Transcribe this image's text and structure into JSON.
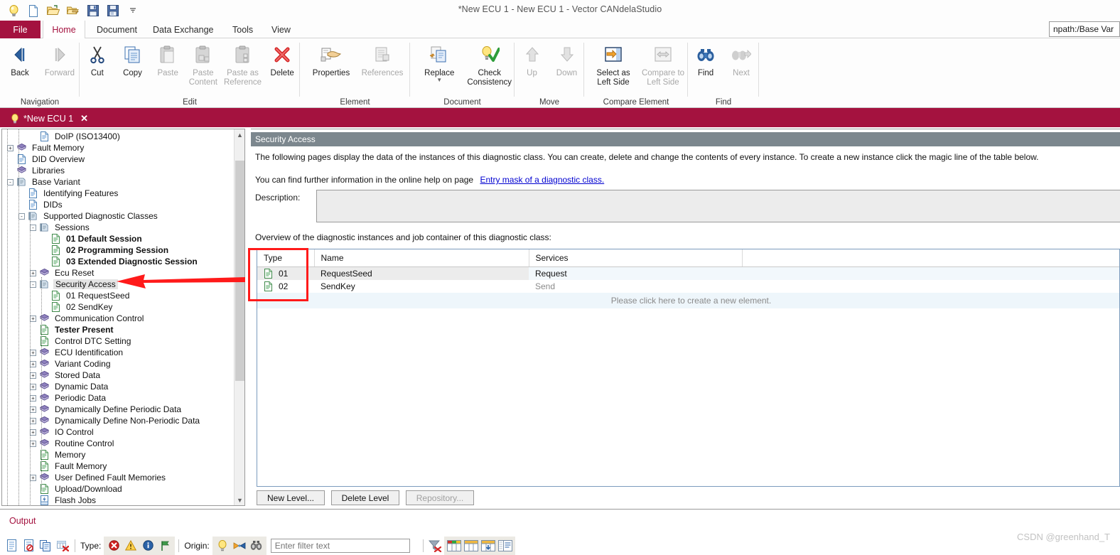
{
  "window": {
    "title": "*New ECU 1 - New ECU 1 - Vector CANdelaStudio"
  },
  "quick_access": {
    "items": [
      {
        "name": "candela-lamp-icon",
        "label": "CANdela"
      },
      {
        "name": "new-document-icon",
        "label": "New"
      },
      {
        "name": "open-folder-icon",
        "label": "Open"
      },
      {
        "name": "open-template-icon",
        "label": "Open Template"
      },
      {
        "name": "save-icon",
        "label": "Save"
      },
      {
        "name": "save-as-icon",
        "label": "Save As"
      },
      {
        "name": "customize-qat-icon",
        "label": "Customize Quick Access Toolbar"
      }
    ]
  },
  "ribbon": {
    "file_tab": "File",
    "tabs": [
      {
        "label": "Home",
        "active": true
      },
      {
        "label": "Document",
        "active": false
      },
      {
        "label": "Data Exchange",
        "active": false
      },
      {
        "label": "Tools",
        "active": false
      },
      {
        "label": "View",
        "active": false
      }
    ],
    "npath_value": "npath:/Base Var",
    "groups": [
      {
        "label": "Navigation",
        "buttons": [
          {
            "label": "Back",
            "icon": "back-arrow-icon",
            "disabled": false
          },
          {
            "label": "Forward",
            "icon": "forward-arrow-icon",
            "disabled": true
          }
        ]
      },
      {
        "label": "Edit",
        "buttons": [
          {
            "label": "Cut",
            "icon": "scissors-icon",
            "disabled": false
          },
          {
            "label": "Copy",
            "icon": "copy-icon",
            "disabled": false
          },
          {
            "label": "Paste",
            "icon": "paste-icon",
            "disabled": true
          },
          {
            "label": "Paste\nContent",
            "icon": "paste-content-icon",
            "disabled": true
          },
          {
            "label": "Paste as\nReference",
            "icon": "paste-reference-icon",
            "disabled": true
          },
          {
            "label": "Delete",
            "icon": "delete-x-icon",
            "disabled": false
          }
        ]
      },
      {
        "label": "Element",
        "buttons": [
          {
            "label": "Properties",
            "icon": "properties-hand-icon",
            "disabled": false
          },
          {
            "label": "References",
            "icon": "references-icon",
            "disabled": true
          }
        ]
      },
      {
        "label": "Document",
        "buttons": [
          {
            "label": "Replace",
            "icon": "replace-icon",
            "disabled": false,
            "dropdown": true
          },
          {
            "label": "Check\nConsistency",
            "icon": "check-consistency-icon",
            "disabled": false
          }
        ]
      },
      {
        "label": "Move",
        "buttons": [
          {
            "label": "Up",
            "icon": "arrow-up-icon",
            "disabled": true
          },
          {
            "label": "Down",
            "icon": "arrow-down-icon",
            "disabled": true
          }
        ]
      },
      {
        "label": "Compare Element",
        "buttons": [
          {
            "label": "Select as\nLeft Side",
            "icon": "select-left-side-icon",
            "disabled": false
          },
          {
            "label": "Compare to\nLeft Side",
            "icon": "compare-left-side-icon",
            "disabled": true
          }
        ]
      },
      {
        "label": "Find",
        "buttons": [
          {
            "label": "Find",
            "icon": "binoculars-icon",
            "disabled": false
          },
          {
            "label": "Next",
            "icon": "binoculars-next-icon",
            "disabled": true
          }
        ]
      }
    ]
  },
  "document_tabs": [
    {
      "label": "*New ECU 1",
      "icon": "candela-lamp-icon",
      "close": "✕",
      "active": true
    }
  ],
  "tree": {
    "nodes": [
      {
        "label": "DoIP (ISO13400)",
        "depth": 3,
        "icon": "blue-doc-icon",
        "expander": "",
        "bold": false,
        "selected": false
      },
      {
        "label": "Fault Memory",
        "depth": 1,
        "icon": "purple-layers-icon",
        "expander": "+",
        "bold": false,
        "selected": false
      },
      {
        "label": "DID Overview",
        "depth": 1,
        "icon": "blue-doc-icon",
        "expander": "",
        "bold": false,
        "selected": false
      },
      {
        "label": "Libraries",
        "depth": 1,
        "icon": "purple-layers-icon",
        "expander": "",
        "bold": false,
        "selected": false
      },
      {
        "label": "Base Variant",
        "depth": 1,
        "icon": "variant-icon",
        "expander": "-",
        "bold": false,
        "selected": false
      },
      {
        "label": "Identifying Features",
        "depth": 2,
        "icon": "blue-doc-icon",
        "expander": "",
        "bold": false,
        "selected": false
      },
      {
        "label": "DIDs",
        "depth": 2,
        "icon": "blue-doc-icon",
        "expander": "",
        "bold": false,
        "selected": false
      },
      {
        "label": "Supported Diagnostic Classes",
        "depth": 2,
        "icon": "variant-icon",
        "expander": "-",
        "bold": false,
        "selected": false
      },
      {
        "label": "Sessions",
        "depth": 3,
        "icon": "variant-icon",
        "expander": "-",
        "bold": false,
        "selected": false
      },
      {
        "label": "01 Default Session",
        "depth": 4,
        "icon": "green-doc-icon",
        "expander": "",
        "bold": true,
        "selected": false
      },
      {
        "label": "02 Programming Session",
        "depth": 4,
        "icon": "green-doc-icon",
        "expander": "",
        "bold": true,
        "selected": false
      },
      {
        "label": "03 Extended Diagnostic Session",
        "depth": 4,
        "icon": "green-doc-icon",
        "expander": "",
        "bold": true,
        "selected": false
      },
      {
        "label": "Ecu Reset",
        "depth": 3,
        "icon": "purple-layers-icon",
        "expander": "+",
        "bold": false,
        "selected": false
      },
      {
        "label": "Security Access",
        "depth": 3,
        "icon": "variant-icon",
        "expander": "-",
        "bold": false,
        "selected": true
      },
      {
        "label": "01 RequestSeed",
        "depth": 4,
        "icon": "green-doc-icon",
        "expander": "",
        "bold": false,
        "selected": false
      },
      {
        "label": "02 SendKey",
        "depth": 4,
        "icon": "green-doc-icon",
        "expander": "",
        "bold": false,
        "selected": false
      },
      {
        "label": "Communication Control",
        "depth": 3,
        "icon": "purple-layers-icon",
        "expander": "+",
        "bold": false,
        "selected": false
      },
      {
        "label": "Tester Present",
        "depth": 3,
        "icon": "green-doc-icon",
        "expander": "",
        "bold": true,
        "selected": false
      },
      {
        "label": "Control DTC Setting",
        "depth": 3,
        "icon": "green-doc-icon",
        "expander": "",
        "bold": false,
        "selected": false
      },
      {
        "label": "ECU Identification",
        "depth": 3,
        "icon": "purple-layers-icon",
        "expander": "+",
        "bold": false,
        "selected": false
      },
      {
        "label": "Variant Coding",
        "depth": 3,
        "icon": "purple-layers-icon",
        "expander": "+",
        "bold": false,
        "selected": false
      },
      {
        "label": "Stored Data",
        "depth": 3,
        "icon": "purple-layers-icon",
        "expander": "+",
        "bold": false,
        "selected": false
      },
      {
        "label": "Dynamic Data",
        "depth": 3,
        "icon": "purple-layers-icon",
        "expander": "+",
        "bold": false,
        "selected": false
      },
      {
        "label": "Periodic Data",
        "depth": 3,
        "icon": "purple-layers-icon",
        "expander": "+",
        "bold": false,
        "selected": false
      },
      {
        "label": "Dynamically Define Periodic Data",
        "depth": 3,
        "icon": "purple-layers-icon",
        "expander": "+",
        "bold": false,
        "selected": false
      },
      {
        "label": "Dynamically Define Non-Periodic Data",
        "depth": 3,
        "icon": "purple-layers-icon",
        "expander": "+",
        "bold": false,
        "selected": false
      },
      {
        "label": "IO Control",
        "depth": 3,
        "icon": "purple-layers-icon",
        "expander": "+",
        "bold": false,
        "selected": false
      },
      {
        "label": "Routine Control",
        "depth": 3,
        "icon": "purple-layers-icon",
        "expander": "+",
        "bold": false,
        "selected": false
      },
      {
        "label": "Memory",
        "depth": 3,
        "icon": "green-doc-icon",
        "expander": "",
        "bold": false,
        "selected": false
      },
      {
        "label": "Fault Memory",
        "depth": 3,
        "icon": "green-doc-icon",
        "expander": "",
        "bold": false,
        "selected": false
      },
      {
        "label": "User Defined Fault Memories",
        "depth": 3,
        "icon": "purple-layers-icon",
        "expander": "+",
        "bold": false,
        "selected": false
      },
      {
        "label": "Upload/Download",
        "depth": 3,
        "icon": "green-doc-icon",
        "expander": "",
        "bold": false,
        "selected": false
      },
      {
        "label": "Flash Jobs",
        "depth": 3,
        "icon": "flash-job-icon",
        "expander": "",
        "bold": false,
        "selected": false
      }
    ]
  },
  "main": {
    "header": "Security Access",
    "intro": "The following pages display the data of the instances of this diagnostic class. You can create, delete and change the contents of every instance. To create a new instance click the magic line of the table below.",
    "help_prefix": "You can find further information in the online help on page",
    "help_link": "Entry mask of a diagnostic class.",
    "description_label": "Description:",
    "description_value": "",
    "overview_label": "Overview of the diagnostic instances and job container of this diagnostic class:",
    "table": {
      "columns": [
        "Type",
        "Name",
        "Services",
        ""
      ],
      "rows": [
        {
          "type": "01",
          "name": "RequestSeed",
          "services": "Request",
          "icon": "green-doc-icon"
        },
        {
          "type": "02",
          "name": "SendKey",
          "services": "Send",
          "icon": "green-doc-icon"
        }
      ],
      "magic_line": "Please click here to create a new element."
    },
    "buttons": [
      {
        "label": "New Level...",
        "disabled": false
      },
      {
        "label": "Delete Level",
        "disabled": false
      },
      {
        "label": "Repository...",
        "disabled": true
      }
    ]
  },
  "output": {
    "title": "Output",
    "tool_buttons": [
      {
        "name": "show-output-icon",
        "label": "Show Output"
      },
      {
        "name": "clear-history-icon",
        "label": "Clear History"
      },
      {
        "name": "copy-rows-icon",
        "label": "Copy"
      },
      {
        "name": "clear-table-icon",
        "label": "Clear"
      }
    ],
    "type_label": "Type:",
    "type_filters": [
      {
        "name": "error-icon",
        "label": "Error"
      },
      {
        "name": "warning-icon",
        "label": "Warning"
      },
      {
        "name": "info-icon",
        "label": "Info"
      },
      {
        "name": "flag-icon",
        "label": "Flag"
      }
    ],
    "origin_label": "Origin:",
    "origin_filters": [
      {
        "name": "candela-lamp-icon",
        "label": "CANdela"
      },
      {
        "name": "exchange-icon",
        "label": "Data Exchange"
      },
      {
        "name": "binoculars-icon",
        "label": "Find"
      }
    ],
    "filter_placeholder": "Enter filter text",
    "filter_value": "",
    "right_buttons": [
      {
        "name": "clear-filter-icon",
        "label": "Clear Filter"
      },
      {
        "name": "colorize-columns-icon",
        "label": "Colorize"
      },
      {
        "name": "columns-icon",
        "label": "Columns"
      },
      {
        "name": "autofit-columns-icon",
        "label": "Autofit"
      },
      {
        "name": "details-view-icon",
        "label": "Details"
      }
    ]
  },
  "watermark": "CSDN @greenhand_T",
  "colors": {
    "brand_red": "#a4123f",
    "header_gray": "#7c878e",
    "annotation_red": "#ff1a1a",
    "link_blue": "#0000d0"
  }
}
